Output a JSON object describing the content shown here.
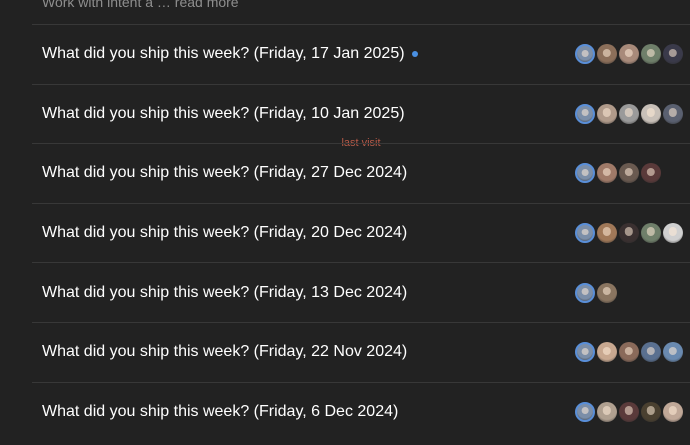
{
  "excerpt": {
    "text": "Work with intent a … read more"
  },
  "divider": {
    "label": "last visit"
  },
  "topics": [
    {
      "title": "What did you ship this week? (Friday, 17 Jan 2025)",
      "unread": true,
      "avatars": [
        "#7b8ea8",
        "#8c6f5a",
        "#a88a7a",
        "#6f7f6a",
        "#3a3a4a"
      ]
    },
    {
      "title": "What did you ship this week? (Friday, 10 Jan 2025)",
      "unread": false,
      "avatars": [
        "#7b8ea8",
        "#b09a8a",
        "#9a9a9a",
        "#c8c0b8",
        "#5a6070"
      ]
    },
    {
      "title": "What did you ship this week? (Friday, 27 Dec 2024)",
      "unread": false,
      "avatars": [
        "#7b8ea8",
        "#a07a68",
        "#6a5a50",
        "#5a3a3a"
      ]
    },
    {
      "title": "What did you ship this week? (Friday, 20 Dec 2024)",
      "unread": false,
      "avatars": [
        "#7b8ea8",
        "#a07858",
        "#3a3030",
        "#6f7f6a",
        "#d0d0d0"
      ]
    },
    {
      "title": "What did you ship this week? (Friday, 13 Dec 2024)",
      "unread": false,
      "avatars": [
        "#7b8ea8",
        "#8a7560"
      ]
    },
    {
      "title": "What did you ship this week? (Friday, 22 Nov 2024)",
      "unread": false,
      "avatars": [
        "#7b8ea8",
        "#c8a890",
        "#8a6a5a",
        "#5a7090",
        "#6a8ab0"
      ]
    },
    {
      "title": "What did you ship this week? (Friday, 6 Dec 2024)",
      "unread": false,
      "avatars": [
        "#7b8ea8",
        "#b0a090",
        "#5a3a3a",
        "#4a4030",
        "#c0a898"
      ]
    }
  ],
  "colors": {
    "background": "#222222",
    "divider_line": "#a3402f",
    "unread_dot": "#4a90e2",
    "original_poster_ring": "#5a8fd8"
  }
}
